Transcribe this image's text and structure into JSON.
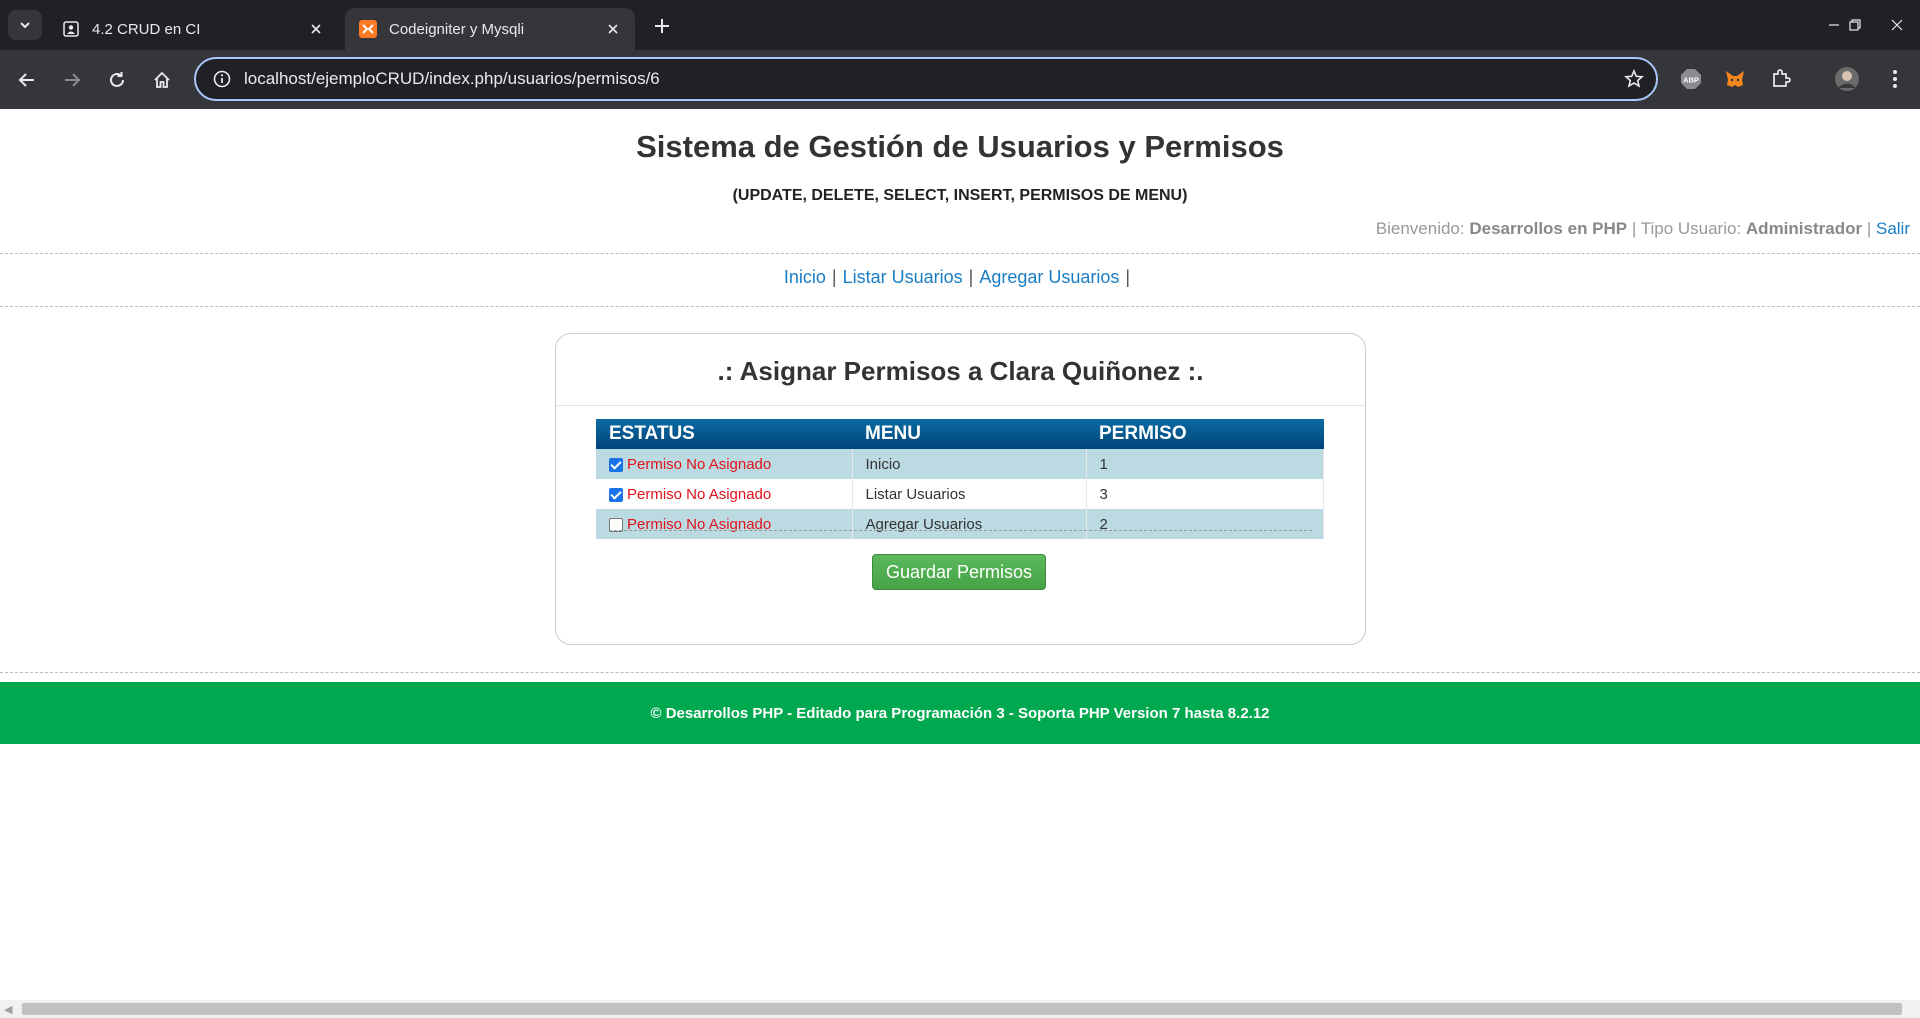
{
  "browser": {
    "tabs": [
      {
        "title": "4.2 CRUD en CI",
        "icon": "contact-page-icon",
        "active": false
      },
      {
        "title": "Codeigniter y Mysqli",
        "icon": "xampp-icon",
        "active": true
      }
    ],
    "url": "localhost/ejemploCRUD/index.php/usuarios/permisos/6",
    "extensions": [
      "adblock-plus-icon",
      "metamask-fox-icon",
      "puzzle-extensions-icon",
      "profile-avatar"
    ]
  },
  "header": {
    "title": "Sistema de Gestión de Usuarios y Permisos",
    "subtitle": "(UPDATE, DELETE, SELECT, INSERT, PERMISOS DE MENU)",
    "welcome_label": "Bienvenido:",
    "user_name": "Desarrollos en PHP",
    "sep1": "|",
    "type_label": "Tipo Usuario:",
    "user_type": "Administrador",
    "sep2": "|",
    "logout": "Salir"
  },
  "menu": {
    "items": [
      "Inicio",
      "Listar Usuarios",
      "Agregar Usuarios"
    ],
    "separator": "|"
  },
  "permissions": {
    "title": ".: Asignar Permisos a Clara Quiñonez :.",
    "columns": [
      "ESTATUS",
      "MENU",
      "PERMISO"
    ],
    "rows": [
      {
        "checked": true,
        "status": "Permiso No Asignado",
        "menu": "Inicio",
        "permiso": "1"
      },
      {
        "checked": true,
        "status": "Permiso No Asignado",
        "menu": "Listar Usuarios",
        "permiso": "3"
      },
      {
        "checked": false,
        "status": "Permiso No Asignado",
        "menu": "Agregar Usuarios",
        "permiso": "2"
      }
    ],
    "save_label": "Guardar Permisos"
  },
  "footer": {
    "text": "© Desarrollos PHP - Editado para Programación 3 - Soporta PHP Version 7 hasta 8.2.12"
  },
  "colors": {
    "table_header": "#00457a",
    "row_alt": "#bcdae2",
    "status_red": "#e0121b",
    "footer_green": "#00a94f",
    "link_blue": "#1a7dc4"
  }
}
